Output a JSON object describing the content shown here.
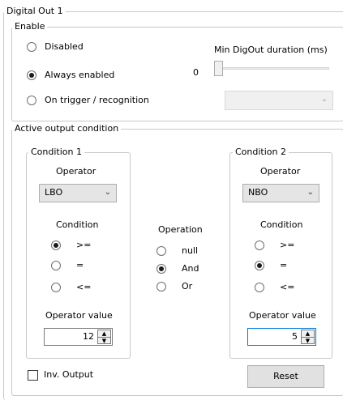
{
  "digital_out": {
    "title": "Digital Out 1",
    "enable": {
      "title": "Enable",
      "options": [
        {
          "label": "Disabled",
          "checked": false
        },
        {
          "label": "Always enabled",
          "checked": true
        },
        {
          "label": "On trigger / recognition",
          "checked": false
        }
      ],
      "min_duration_label": "Min DigOut duration (ms)",
      "min_duration_value": "0",
      "trigger_combo_value": ""
    },
    "active_output": {
      "title": "Active output condition",
      "condition1": {
        "title": "Condition 1",
        "operator_label": "Operator",
        "operator_value": "LBO",
        "condition_label": "Condition",
        "conditions": [
          {
            "label": ">=",
            "checked": true
          },
          {
            "label": "=",
            "checked": false
          },
          {
            "label": "<=",
            "checked": false
          }
        ],
        "operator_value_label": "Operator value",
        "value": "12"
      },
      "operation": {
        "label": "Operation",
        "options": [
          {
            "label": "null",
            "checked": false
          },
          {
            "label": "And",
            "checked": true
          },
          {
            "label": "Or",
            "checked": false
          }
        ]
      },
      "condition2": {
        "title": "Condition 2",
        "operator_label": "Operator",
        "operator_value": "NBO",
        "condition_label": "Condition",
        "conditions": [
          {
            "label": ">=",
            "checked": false
          },
          {
            "label": "=",
            "checked": true
          },
          {
            "label": "<=",
            "checked": false
          }
        ],
        "operator_value_label": "Operator value",
        "value": "5"
      },
      "inv_output_label": "Inv. Output",
      "inv_output_checked": false,
      "reset_label": "Reset"
    },
    "icons": {
      "dropdown": "chevron-down-icon",
      "spin_up": "caret-up-icon",
      "spin_down": "caret-down-icon"
    }
  }
}
